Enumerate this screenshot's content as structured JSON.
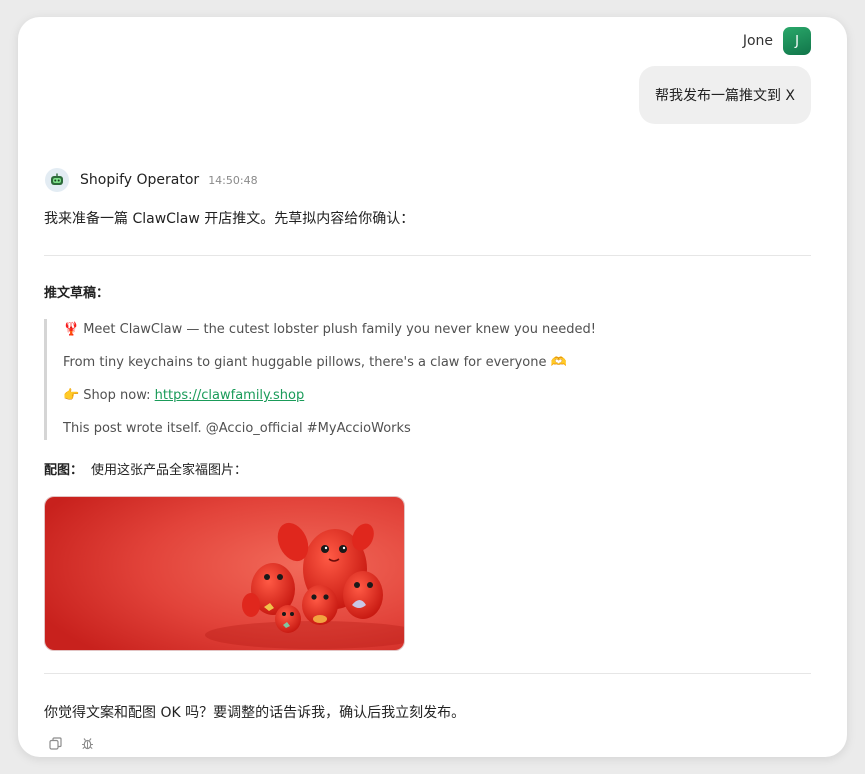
{
  "user": {
    "name": "Jone",
    "avatar_initial": "J",
    "message": "帮我发布一篇推文到 X"
  },
  "agent": {
    "name": "Shopify Operator",
    "time": "14:50:48",
    "avatar_icon": "robot-icon",
    "intro": "我来准备一篇 ClawClaw 开店推文。先草拟内容给你确认：",
    "draft_title": "推文草稿：",
    "draft": {
      "line1_emoji": "🦞",
      "line1": "Meet ClawClaw — the cutest lobster plush family you never knew you needed!",
      "line2": "From tiny keychains to giant huggable pillows, there's a claw for everyone",
      "line2_emoji": "🫶",
      "line3_emoji": "👉",
      "line3_prefix": "Shop now: ",
      "line3_link": "https://clawfamily.shop",
      "line4": "This post wrote itself. @Accio_official #MyAccioWorks"
    },
    "image_label": "配图：",
    "image_text": "使用这张产品全家福图片：",
    "image_alt": "lobster plush family photo",
    "closing": "你觉得文案和配图 OK 吗？要调整的话告诉我，确认后我立刻发布。"
  },
  "actions": [
    "copy-icon",
    "bug-icon"
  ],
  "colors": {
    "accent": "#1a9b59",
    "avatar_green": "#1f8f5a",
    "bubble": "#efefef",
    "image_red": "#d9302b"
  }
}
